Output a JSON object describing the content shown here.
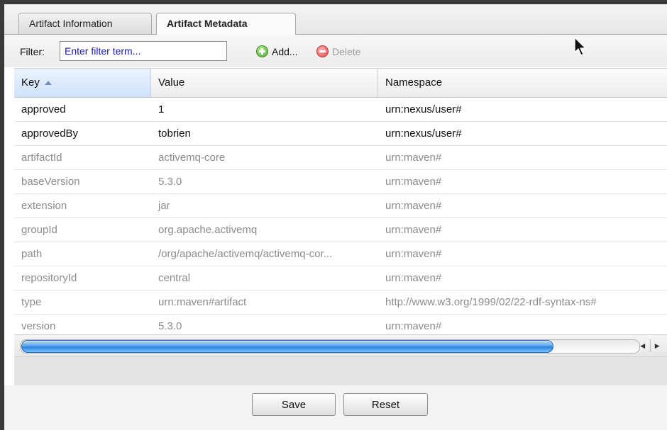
{
  "tabs": [
    {
      "label": "Artifact Information"
    },
    {
      "label": "Artifact Metadata"
    }
  ],
  "toolbar": {
    "filter_label": "Filter:",
    "filter_placeholder": "Enter filter term...",
    "add_label": "Add...",
    "delete_label": "Delete"
  },
  "grid": {
    "columns": {
      "key": "Key",
      "value": "Value",
      "namespace": "Namespace"
    },
    "rows": [
      {
        "key": "approved",
        "value": "1",
        "namespace": "urn:nexus/user#"
      },
      {
        "key": "approvedBy",
        "value": "tobrien",
        "namespace": "urn:nexus/user#"
      },
      {
        "key": "artifactId",
        "value": "activemq-core",
        "namespace": "urn:maven#"
      },
      {
        "key": "baseVersion",
        "value": "5.3.0",
        "namespace": "urn:maven#"
      },
      {
        "key": "extension",
        "value": "jar",
        "namespace": "urn:maven#"
      },
      {
        "key": "groupId",
        "value": "org.apache.activemq",
        "namespace": "urn:maven#"
      },
      {
        "key": "path",
        "value": "/org/apache/activemq/activemq-cor...",
        "namespace": "urn:maven#"
      },
      {
        "key": "repositoryId",
        "value": "central",
        "namespace": "urn:maven#"
      },
      {
        "key": "type",
        "value": "urn:maven#artifact",
        "namespace": "http://www.w3.org/1999/02/22-rdf-syntax-ns#"
      },
      {
        "key": "version",
        "value": "5.3.0",
        "namespace": "urn:maven#"
      }
    ]
  },
  "scrollbar": {
    "left_arrow": "◀",
    "right_arrow": "▶"
  },
  "footer": {
    "save_label": "Save",
    "reset_label": "Reset"
  },
  "colors": {
    "editable_text": "#111111",
    "readonly_text": "#8c8c8c",
    "filter_text": "#1a1aa0",
    "scroll_thumb": "#2c83dd"
  }
}
